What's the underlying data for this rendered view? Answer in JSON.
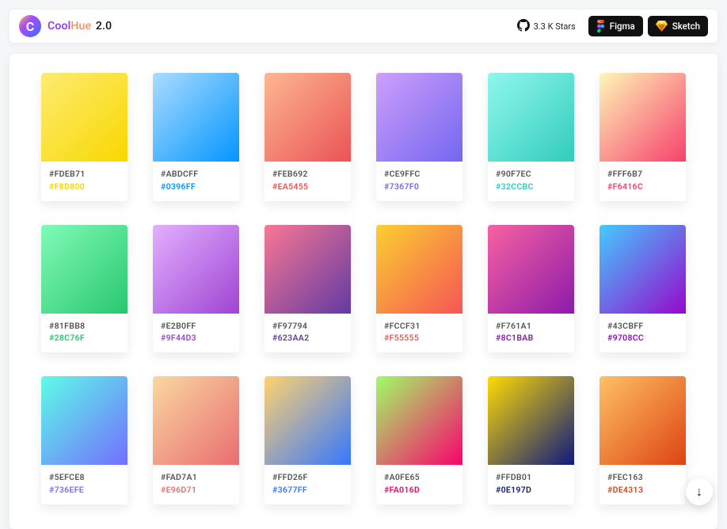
{
  "header": {
    "logo_letter": "C",
    "brand_cool": "Cool",
    "brand_hue": "Hue",
    "brand_version": "2.0",
    "stars_label": "3.3 K Stars",
    "figma_label": "Figma",
    "sketch_label": "Sketch"
  },
  "fab": {
    "glyph": "↓"
  },
  "swatches": [
    {
      "from": "#FDEB71",
      "to": "#F8D800"
    },
    {
      "from": "#ABDCFF",
      "to": "#0396FF"
    },
    {
      "from": "#FEB692",
      "to": "#EA5455"
    },
    {
      "from": "#CE9FFC",
      "to": "#7367F0"
    },
    {
      "from": "#90F7EC",
      "to": "#32CCBC"
    },
    {
      "from": "#FFF6B7",
      "to": "#F6416C"
    },
    {
      "from": "#81FBB8",
      "to": "#28C76F"
    },
    {
      "from": "#E2B0FF",
      "to": "#9F44D3"
    },
    {
      "from": "#F97794",
      "to": "#623AA2"
    },
    {
      "from": "#FCCF31",
      "to": "#F55555"
    },
    {
      "from": "#F761A1",
      "to": "#8C1BAB"
    },
    {
      "from": "#43CBFF",
      "to": "#9708CC"
    },
    {
      "from": "#5EFCE8",
      "to": "#736EFE"
    },
    {
      "from": "#FAD7A1",
      "to": "#E96D71"
    },
    {
      "from": "#FFD26F",
      "to": "#3677FF"
    },
    {
      "from": "#A0FE65",
      "to": "#FA016D"
    },
    {
      "from": "#FFDB01",
      "to": "#0E197D"
    },
    {
      "from": "#FEC163",
      "to": "#DE4313"
    }
  ]
}
